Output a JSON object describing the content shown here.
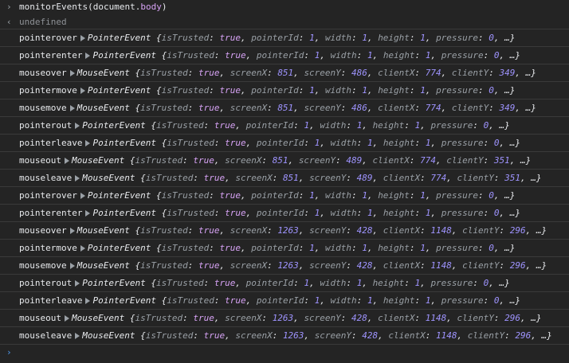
{
  "command": {
    "prefix": "monitorEvents(document.",
    "arg": "body",
    "suffix": ")"
  },
  "result": "undefined",
  "glyphs": {
    "input": "›",
    "output": "‹",
    "prompt": "›"
  },
  "events": [
    {
      "name": "pointerover",
      "cls": "PointerEvent",
      "props": [
        [
          "isTrusted",
          "true",
          "bool"
        ],
        [
          "pointerId",
          "1",
          "num"
        ],
        [
          "width",
          "1",
          "num"
        ],
        [
          "height",
          "1",
          "num"
        ],
        [
          "pressure",
          "0",
          "num"
        ]
      ]
    },
    {
      "name": "pointerenter",
      "cls": "PointerEvent",
      "props": [
        [
          "isTrusted",
          "true",
          "bool"
        ],
        [
          "pointerId",
          "1",
          "num"
        ],
        [
          "width",
          "1",
          "num"
        ],
        [
          "height",
          "1",
          "num"
        ],
        [
          "pressure",
          "0",
          "num"
        ]
      ]
    },
    {
      "name": "mouseover",
      "cls": "MouseEvent",
      "props": [
        [
          "isTrusted",
          "true",
          "bool"
        ],
        [
          "screenX",
          "851",
          "num"
        ],
        [
          "screenY",
          "486",
          "num"
        ],
        [
          "clientX",
          "774",
          "num"
        ],
        [
          "clientY",
          "349",
          "num"
        ]
      ]
    },
    {
      "name": "pointermove",
      "cls": "PointerEvent",
      "props": [
        [
          "isTrusted",
          "true",
          "bool"
        ],
        [
          "pointerId",
          "1",
          "num"
        ],
        [
          "width",
          "1",
          "num"
        ],
        [
          "height",
          "1",
          "num"
        ],
        [
          "pressure",
          "0",
          "num"
        ]
      ]
    },
    {
      "name": "mousemove",
      "cls": "MouseEvent",
      "props": [
        [
          "isTrusted",
          "true",
          "bool"
        ],
        [
          "screenX",
          "851",
          "num"
        ],
        [
          "screenY",
          "486",
          "num"
        ],
        [
          "clientX",
          "774",
          "num"
        ],
        [
          "clientY",
          "349",
          "num"
        ]
      ]
    },
    {
      "name": "pointerout",
      "cls": "PointerEvent",
      "props": [
        [
          "isTrusted",
          "true",
          "bool"
        ],
        [
          "pointerId",
          "1",
          "num"
        ],
        [
          "width",
          "1",
          "num"
        ],
        [
          "height",
          "1",
          "num"
        ],
        [
          "pressure",
          "0",
          "num"
        ]
      ]
    },
    {
      "name": "pointerleave",
      "cls": "PointerEvent",
      "props": [
        [
          "isTrusted",
          "true",
          "bool"
        ],
        [
          "pointerId",
          "1",
          "num"
        ],
        [
          "width",
          "1",
          "num"
        ],
        [
          "height",
          "1",
          "num"
        ],
        [
          "pressure",
          "0",
          "num"
        ]
      ]
    },
    {
      "name": "mouseout",
      "cls": "MouseEvent",
      "props": [
        [
          "isTrusted",
          "true",
          "bool"
        ],
        [
          "screenX",
          "851",
          "num"
        ],
        [
          "screenY",
          "489",
          "num"
        ],
        [
          "clientX",
          "774",
          "num"
        ],
        [
          "clientY",
          "351",
          "num"
        ]
      ]
    },
    {
      "name": "mouseleave",
      "cls": "MouseEvent",
      "props": [
        [
          "isTrusted",
          "true",
          "bool"
        ],
        [
          "screenX",
          "851",
          "num"
        ],
        [
          "screenY",
          "489",
          "num"
        ],
        [
          "clientX",
          "774",
          "num"
        ],
        [
          "clientY",
          "351",
          "num"
        ]
      ]
    },
    {
      "name": "pointerover",
      "cls": "PointerEvent",
      "props": [
        [
          "isTrusted",
          "true",
          "bool"
        ],
        [
          "pointerId",
          "1",
          "num"
        ],
        [
          "width",
          "1",
          "num"
        ],
        [
          "height",
          "1",
          "num"
        ],
        [
          "pressure",
          "0",
          "num"
        ]
      ]
    },
    {
      "name": "pointerenter",
      "cls": "PointerEvent",
      "props": [
        [
          "isTrusted",
          "true",
          "bool"
        ],
        [
          "pointerId",
          "1",
          "num"
        ],
        [
          "width",
          "1",
          "num"
        ],
        [
          "height",
          "1",
          "num"
        ],
        [
          "pressure",
          "0",
          "num"
        ]
      ]
    },
    {
      "name": "mouseover",
      "cls": "MouseEvent",
      "props": [
        [
          "isTrusted",
          "true",
          "bool"
        ],
        [
          "screenX",
          "1263",
          "num"
        ],
        [
          "screenY",
          "428",
          "num"
        ],
        [
          "clientX",
          "1148",
          "num"
        ],
        [
          "clientY",
          "296",
          "num"
        ]
      ]
    },
    {
      "name": "pointermove",
      "cls": "PointerEvent",
      "props": [
        [
          "isTrusted",
          "true",
          "bool"
        ],
        [
          "pointerId",
          "1",
          "num"
        ],
        [
          "width",
          "1",
          "num"
        ],
        [
          "height",
          "1",
          "num"
        ],
        [
          "pressure",
          "0",
          "num"
        ]
      ]
    },
    {
      "name": "mousemove",
      "cls": "MouseEvent",
      "props": [
        [
          "isTrusted",
          "true",
          "bool"
        ],
        [
          "screenX",
          "1263",
          "num"
        ],
        [
          "screenY",
          "428",
          "num"
        ],
        [
          "clientX",
          "1148",
          "num"
        ],
        [
          "clientY",
          "296",
          "num"
        ]
      ]
    },
    {
      "name": "pointerout",
      "cls": "PointerEvent",
      "props": [
        [
          "isTrusted",
          "true",
          "bool"
        ],
        [
          "pointerId",
          "1",
          "num"
        ],
        [
          "width",
          "1",
          "num"
        ],
        [
          "height",
          "1",
          "num"
        ],
        [
          "pressure",
          "0",
          "num"
        ]
      ]
    },
    {
      "name": "pointerleave",
      "cls": "PointerEvent",
      "props": [
        [
          "isTrusted",
          "true",
          "bool"
        ],
        [
          "pointerId",
          "1",
          "num"
        ],
        [
          "width",
          "1",
          "num"
        ],
        [
          "height",
          "1",
          "num"
        ],
        [
          "pressure",
          "0",
          "num"
        ]
      ]
    },
    {
      "name": "mouseout",
      "cls": "MouseEvent",
      "props": [
        [
          "isTrusted",
          "true",
          "bool"
        ],
        [
          "screenX",
          "1263",
          "num"
        ],
        [
          "screenY",
          "428",
          "num"
        ],
        [
          "clientX",
          "1148",
          "num"
        ],
        [
          "clientY",
          "296",
          "num"
        ]
      ]
    },
    {
      "name": "mouseleave",
      "cls": "MouseEvent",
      "props": [
        [
          "isTrusted",
          "true",
          "bool"
        ],
        [
          "screenX",
          "1263",
          "num"
        ],
        [
          "screenY",
          "428",
          "num"
        ],
        [
          "clientX",
          "1148",
          "num"
        ],
        [
          "clientY",
          "296",
          "num"
        ]
      ]
    }
  ],
  "ellipsis": "…",
  "colors": {
    "background": "#242424",
    "boolean": "#d7a3f5",
    "number": "#9f94ff",
    "key": "#9aa0a6",
    "prompt": "#4d9bf0"
  }
}
